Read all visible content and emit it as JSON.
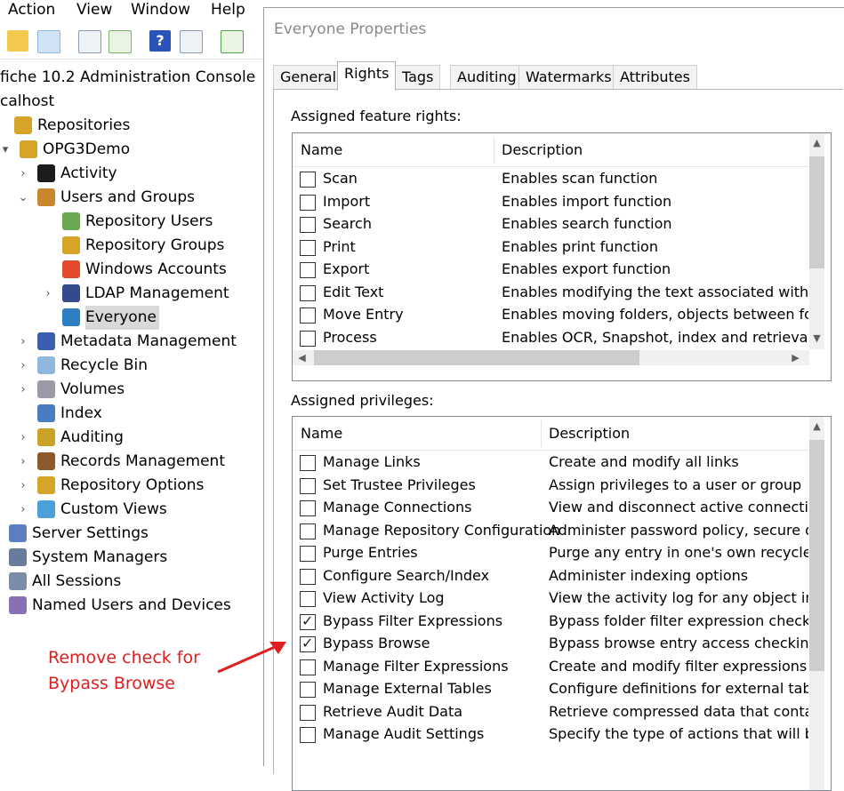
{
  "menu": {
    "items": [
      "Action",
      "View",
      "Window",
      "Help"
    ]
  },
  "toolbar": {
    "icons": [
      "folder-up-icon",
      "show-hide-tree-icon",
      "properties-icon",
      "export-list-icon",
      "help-icon",
      "console-icon",
      "refresh-icon"
    ]
  },
  "tree": {
    "items": [
      {
        "label": "fiche 10.2 Administration Console",
        "icon": "none"
      },
      {
        "label": "calhost",
        "icon": "none"
      },
      {
        "label": "Repositories",
        "icon": "repositories-icon"
      },
      {
        "label": "OPG3Demo",
        "icon": "repository-icon"
      },
      {
        "label": "Activity",
        "icon": "activity-icon"
      },
      {
        "label": "Users and Groups",
        "icon": "users-groups-icon"
      },
      {
        "label": "Repository Users",
        "icon": "user-icon"
      },
      {
        "label": "Repository Groups",
        "icon": "group-icon"
      },
      {
        "label": "Windows Accounts",
        "icon": "windows-icon"
      },
      {
        "label": "LDAP Management",
        "icon": "ldap-icon"
      },
      {
        "label": "Everyone",
        "icon": "globe-icon"
      },
      {
        "label": "Metadata Management",
        "icon": "metadata-icon"
      },
      {
        "label": "Recycle Bin",
        "icon": "recycle-bin-icon"
      },
      {
        "label": "Volumes",
        "icon": "volumes-icon"
      },
      {
        "label": "Index",
        "icon": "index-icon"
      },
      {
        "label": "Auditing",
        "icon": "auditing-icon"
      },
      {
        "label": "Records Management",
        "icon": "records-icon"
      },
      {
        "label": "Repository Options",
        "icon": "options-icon"
      },
      {
        "label": "Custom Views",
        "icon": "custom-views-icon"
      },
      {
        "label": "Server Settings",
        "icon": "server-icon"
      },
      {
        "label": "System Managers",
        "icon": "managers-icon"
      },
      {
        "label": "All Sessions",
        "icon": "sessions-icon"
      },
      {
        "label": "Named Users and Devices",
        "icon": "named-users-icon"
      }
    ]
  },
  "dialog": {
    "title": "Everyone Properties",
    "tabs": [
      "General",
      "Rights",
      "Tags",
      "Auditing",
      "Watermarks",
      "Attributes"
    ],
    "active_tab": "Rights",
    "features": {
      "label": "Assigned feature rights:",
      "col_name": "Name",
      "col_desc": "Description",
      "rows": [
        {
          "name": "Scan",
          "desc": "Enables scan function",
          "checked": false
        },
        {
          "name": "Import",
          "desc": "Enables import function",
          "checked": false
        },
        {
          "name": "Search",
          "desc": "Enables search function",
          "checked": false
        },
        {
          "name": "Print",
          "desc": "Enables print function",
          "checked": false
        },
        {
          "name": "Export",
          "desc": "Enables export function",
          "checked": false
        },
        {
          "name": "Edit Text",
          "desc": "Enables modifying the text associated with a do",
          "checked": false
        },
        {
          "name": "Move Entry",
          "desc": "Enables moving folders, objects between folder",
          "checked": false
        },
        {
          "name": "Process",
          "desc": "Enables OCR, Snapshot, index and retrieval of t",
          "checked": false
        }
      ]
    },
    "privileges": {
      "label": "Assigned privileges:",
      "col_name": "Name",
      "col_desc": "Description",
      "rows": [
        {
          "name": "Manage Links",
          "desc": "Create and modify all links",
          "checked": false
        },
        {
          "name": "Set Trustee Privileges",
          "desc": "Assign privileges to a user or group",
          "checked": false
        },
        {
          "name": "Manage Connections",
          "desc": "View and disconnect active connections",
          "checked": false
        },
        {
          "name": "Manage Repository Configuration",
          "desc": "Administer password policy, secure delet",
          "checked": false
        },
        {
          "name": "Purge Entries",
          "desc": "Purge any entry in one's own recycle bin",
          "checked": false
        },
        {
          "name": "Configure Search/Index",
          "desc": "Administer indexing options",
          "checked": false
        },
        {
          "name": "View Activity Log",
          "desc": "View the activity log for any object in the",
          "checked": false
        },
        {
          "name": "Bypass Filter Expressions",
          "desc": "Bypass folder filter expression checking w",
          "checked": true
        },
        {
          "name": "Bypass Browse",
          "desc": "Bypass browse entry access checking wh",
          "checked": true
        },
        {
          "name": "Manage Filter Expressions",
          "desc": "Create and modify filter expressions",
          "checked": false
        },
        {
          "name": "Manage External Tables",
          "desc": "Configure definitions for external tables",
          "checked": false
        },
        {
          "name": "Retrieve Audit Data",
          "desc": "Retrieve compressed data that contains",
          "checked": false
        },
        {
          "name": "Manage Audit Settings",
          "desc": "Specify the type of actions that will be a",
          "checked": false
        }
      ]
    }
  },
  "annotation": {
    "line1": "Remove check for",
    "line2": "Bypass Browse",
    "color": "#e02020"
  }
}
